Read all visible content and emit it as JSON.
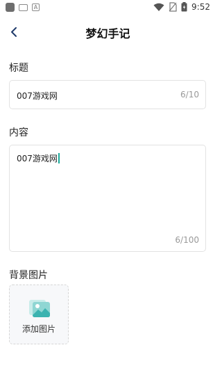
{
  "status_bar": {
    "time": "9:52",
    "app_icon_letter": "A"
  },
  "nav": {
    "title": "梦幻手记"
  },
  "form": {
    "title_label": "标题",
    "title_value": "007游戏网",
    "title_counter": "6/10",
    "content_label": "内容",
    "content_value": "007游戏网",
    "content_counter": "6/100",
    "bg_label": "背景图片",
    "add_image_label": "添加图片"
  },
  "colors": {
    "accent": "#1aa99a",
    "back_arrow": "#1f3a6b",
    "image_icon": "#3bb3b0"
  }
}
